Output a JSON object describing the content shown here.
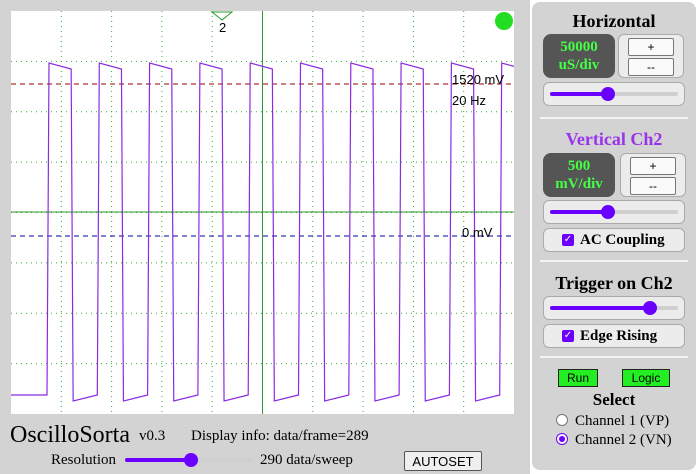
{
  "app": {
    "name": "OscilloSorta",
    "version": "v0.3"
  },
  "display_info": "Display info: data/frame=289",
  "resolution": {
    "label": "Resolution",
    "value_text": "290 data/sweep",
    "slider_fraction": 0.52
  },
  "autoset_label": "AUTOSET",
  "scope": {
    "trigger_marker_label": "2",
    "status_color": "#22dd22",
    "measure_peak": "1520 mV",
    "measure_freq": "20 Hz",
    "measure_zero": "0 mV",
    "trace_color": "#8a2be2",
    "trace_cycles": 10
  },
  "horizontal": {
    "title": "Horizontal",
    "readout_value": "50000",
    "readout_unit": "uS/div",
    "plus_label": "+",
    "minus_label": "--",
    "slider_fraction": 0.45
  },
  "vertical": {
    "title": "Vertical Ch2",
    "readout_value": "500",
    "readout_unit": "mV/div",
    "plus_label": "+",
    "minus_label": "--",
    "slider_fraction": 0.45,
    "ac_coupling_label": "AC Coupling",
    "ac_coupling_checked": true
  },
  "trigger": {
    "title": "Trigger on Ch2",
    "slider_fraction": 0.82,
    "edge_label": "Edge Rising",
    "edge_checked": true
  },
  "run_label": "Run",
  "logic_label": "Logic",
  "select": {
    "title": "Select",
    "options": [
      {
        "label": "Channel 1 (VP)",
        "selected": false
      },
      {
        "label": "Channel 2 (VN)",
        "selected": true
      }
    ]
  },
  "colors": {
    "accent": "#6a00ff",
    "vertical_title": "#9933ee",
    "readout_text": "#44ff44",
    "button_green": "#22ee22"
  }
}
